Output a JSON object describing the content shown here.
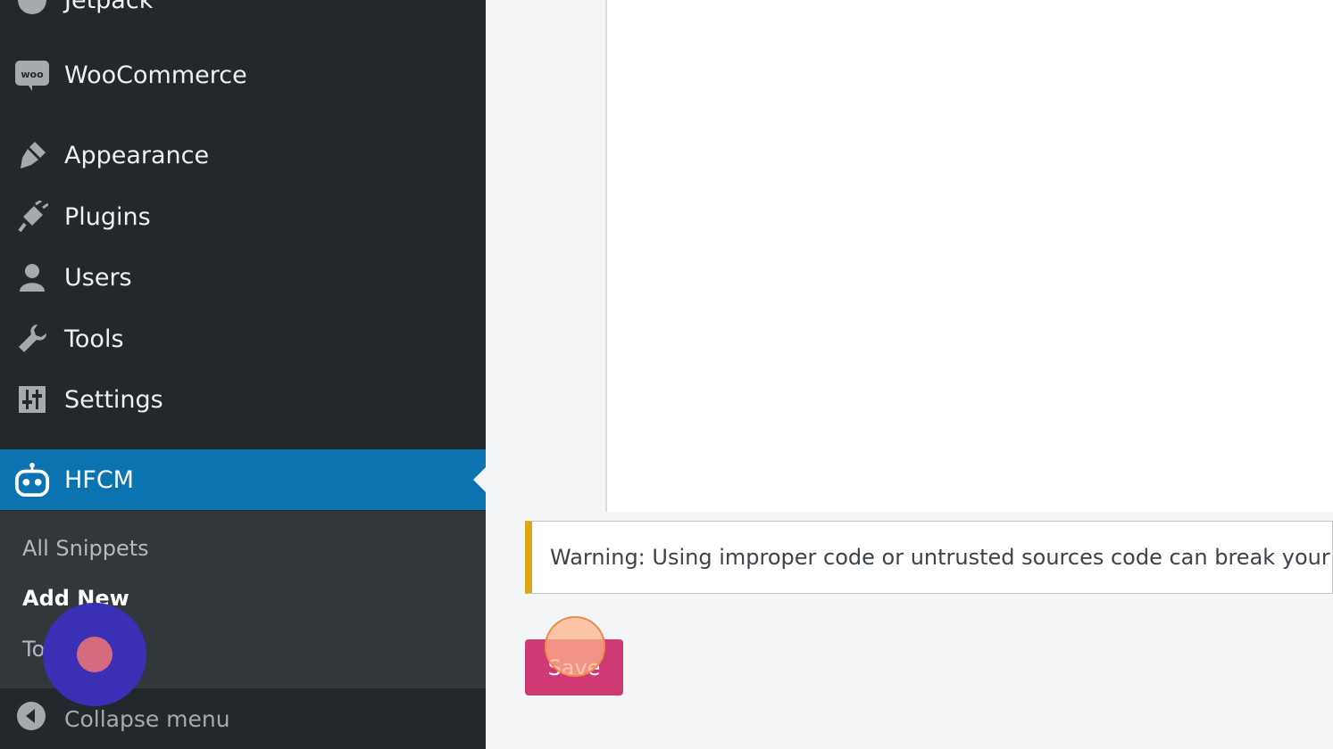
{
  "sidebar": {
    "partial_top_label": "Jetpack",
    "items": [
      {
        "label": "WooCommerce",
        "icon": "woocommerce-icon"
      },
      {
        "label": "Appearance",
        "icon": "paintbrush-icon"
      },
      {
        "label": "Plugins",
        "icon": "plugin-icon"
      },
      {
        "label": "Users",
        "icon": "user-icon"
      },
      {
        "label": "Tools",
        "icon": "wrench-icon"
      },
      {
        "label": "Settings",
        "icon": "settings-sliders-icon"
      },
      {
        "label": "HFCM",
        "icon": "robot-icon"
      }
    ],
    "submenu": [
      "All Snippets",
      "Add New",
      "To"
    ],
    "collapse_label": "Collapse menu"
  },
  "main": {
    "warning": "Warning: Using improper code or untrusted sources code can break your",
    "save_label": "Save"
  },
  "colors": {
    "sidebar_bg": "#23282d",
    "active_bg": "#0b73b0",
    "save_bg": "#cf3a74",
    "warning_border": "#dba617"
  }
}
